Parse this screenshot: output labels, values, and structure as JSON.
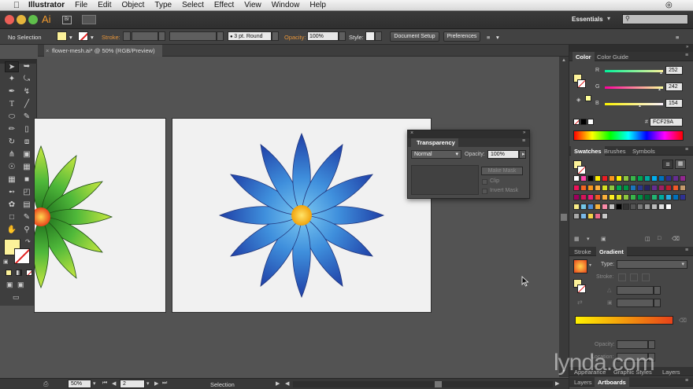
{
  "menubar": {
    "app_name": "Illustrator",
    "items": [
      "File",
      "Edit",
      "Object",
      "Type",
      "Select",
      "Effect",
      "View",
      "Window",
      "Help"
    ]
  },
  "appbar": {
    "logo": "Ai",
    "bridge": "Br",
    "workspace": "Essentials",
    "search_placeholder": ""
  },
  "control": {
    "selection": "No Selection",
    "stroke_label": "Stroke:",
    "brush": "3 pt. Round",
    "opacity_label": "Opacity:",
    "opacity_value": "100%",
    "style_label": "Style:",
    "document_setup": "Document Setup",
    "preferences": "Preferences"
  },
  "document": {
    "tab_title": "flower-mesh.ai* @ 50% (RGB/Preview)"
  },
  "status": {
    "zoom": "50%",
    "artboard": "2",
    "tool": "Selection"
  },
  "color_panel": {
    "tabs": [
      "Color",
      "Color Guide"
    ],
    "r_label": "R",
    "g_label": "G",
    "b_label": "B",
    "r": "252",
    "g": "242",
    "b": "154",
    "hex_label": "#",
    "hex": "FCF29A",
    "fill_color": "#FCF29A"
  },
  "swatches_panel": {
    "tabs": [
      "Swatches",
      "Brushes",
      "Symbols"
    ]
  },
  "stroke_gradient_panel": {
    "tabs": [
      "Stroke",
      "Gradient"
    ],
    "type_label": "Type:",
    "stroke_label": "Stroke:",
    "opacity_label": "Opacity:",
    "location_label": "Location:"
  },
  "bottom_panels": {
    "row1": [
      "Appearance",
      "Graphic Styles",
      "Layers"
    ],
    "row2": [
      "Layers",
      "Artboards"
    ]
  },
  "transparency_panel": {
    "title": "Transparency",
    "blend_mode": "Normal",
    "opacity_label": "Opacity:",
    "opacity_value": "100%",
    "make_mask": "Make Mask",
    "clip": "Clip",
    "invert_mask": "Invert Mask"
  },
  "watermark": "lynda.com"
}
